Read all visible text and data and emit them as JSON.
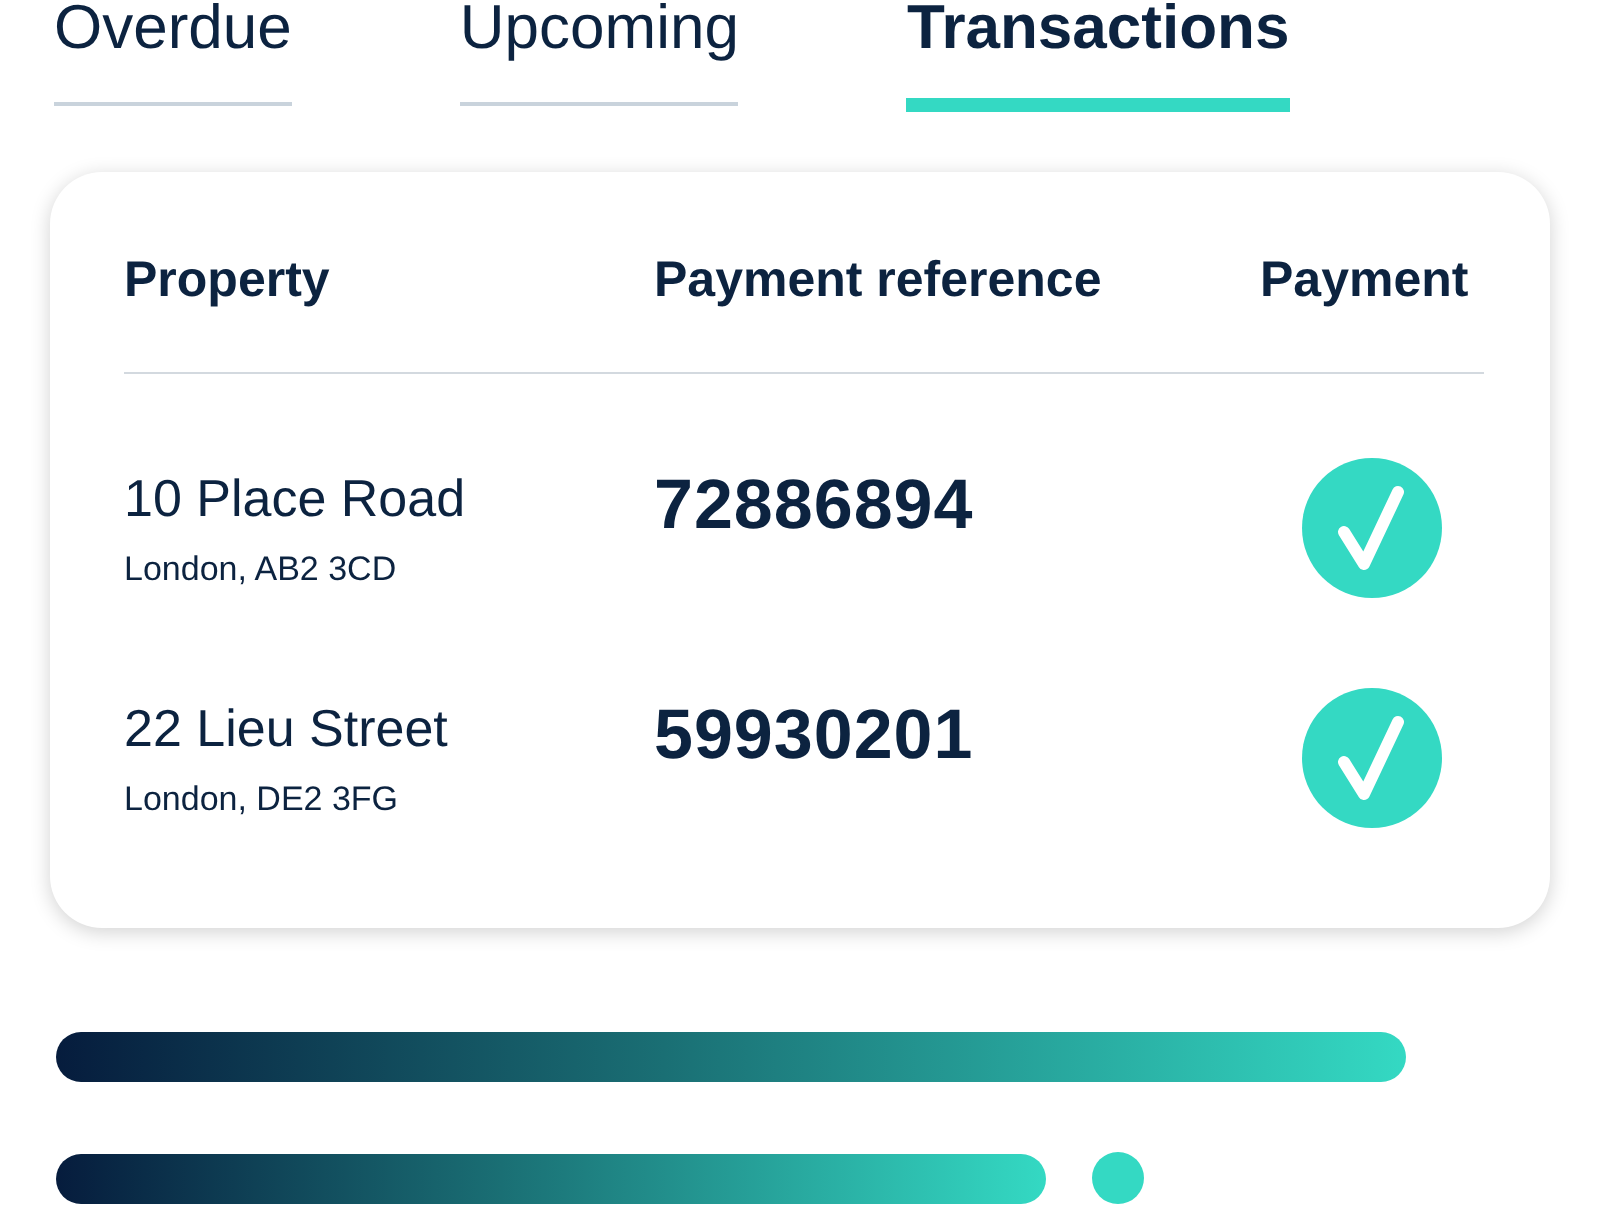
{
  "tabs": [
    {
      "label": "Overdue",
      "selected": false
    },
    {
      "label": "Upcoming",
      "selected": false
    },
    {
      "label": "Transactions",
      "selected": true
    }
  ],
  "table": {
    "columns": [
      "Property",
      "Payment reference",
      "Payment"
    ],
    "rows": [
      {
        "address": "10 Place Road",
        "city": "London, AB2 3CD",
        "reference": "72886894",
        "paid": true
      },
      {
        "address": "22 Lieu Street",
        "city": "London, DE2 3FG",
        "reference": "59930201",
        "paid": true
      }
    ]
  }
}
